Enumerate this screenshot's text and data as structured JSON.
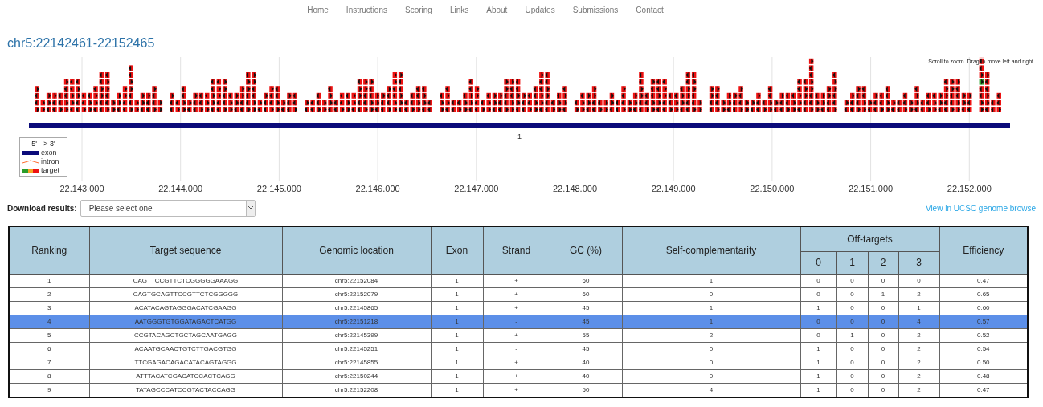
{
  "nav": [
    "Home",
    "Instructions",
    "Scoring",
    "Links",
    "About",
    "Updates",
    "Submissions",
    "Contact"
  ],
  "title": "chr5:22142461-22152465",
  "track": {
    "hint": "Scroll to zoom. Drag to move left and right",
    "exon_label": "1",
    "legend": {
      "title": "5' --> 3'",
      "items": [
        {
          "kind": "exon",
          "label": "exon"
        },
        {
          "kind": "intron",
          "label": "intron"
        },
        {
          "kind": "target",
          "label": "target"
        }
      ]
    },
    "ticks": [
      "22.143.000",
      "22.144.000",
      "22.145.000",
      "22.146.000",
      "22.147.000",
      "22.148.000",
      "22.149.000",
      "22.150.000",
      "22.151.000",
      "22.152.000"
    ]
  },
  "download": {
    "label": "Download results:",
    "placeholder": "Please select one"
  },
  "ucsc_link": "View in UCSC genome browse",
  "table": {
    "columns": [
      "Ranking",
      "Target sequence",
      "Genomic location",
      "Exon",
      "Strand",
      "GC (%)",
      "Self-complementarity"
    ],
    "group": "Off-targets",
    "sub_columns": [
      "0",
      "1",
      "2",
      "3"
    ],
    "last_column": "Efficiency",
    "rows": [
      {
        "selected": false,
        "cells": [
          "1",
          "CAGTTCCGTTCTCGGGGGAAAGG",
          "chr5:22152084",
          "1",
          "+",
          "60",
          "1",
          "0",
          "0",
          "0",
          "0",
          "0.47"
        ]
      },
      {
        "selected": false,
        "cells": [
          "2",
          "CAGTGCAGTTCCGTTCTCGGGGG",
          "chr5:22152079",
          "1",
          "+",
          "60",
          "0",
          "0",
          "0",
          "1",
          "2",
          "0.65"
        ]
      },
      {
        "selected": false,
        "cells": [
          "3",
          "ACATACAGTAGGGACATCGAAGG",
          "chr5:22145865",
          "1",
          "+",
          "45",
          "1",
          "1",
          "0",
          "0",
          "1",
          "0.60"
        ]
      },
      {
        "selected": true,
        "cells": [
          "4",
          "AATGGGTGTGGATAGACTCATGG",
          "chr5:22151218",
          "1",
          "-",
          "45",
          "1",
          "0",
          "0",
          "0",
          "4",
          "0.57"
        ]
      },
      {
        "selected": false,
        "cells": [
          "5",
          "CCGTACAGCTGCTAGCAATGAGG",
          "chr5:22145399",
          "1",
          "+",
          "55",
          "2",
          "0",
          "1",
          "0",
          "2",
          "0.52"
        ]
      },
      {
        "selected": false,
        "cells": [
          "6",
          "ACAATGCAACTGTCTTGACGTGG",
          "chr5:22145251",
          "1",
          "-",
          "45",
          "0",
          "1",
          "0",
          "0",
          "2",
          "0.54"
        ]
      },
      {
        "selected": false,
        "cells": [
          "7",
          "TTCGAGACAGACATACAGTAGGG",
          "chr5:22145855",
          "1",
          "+",
          "40",
          "0",
          "1",
          "0",
          "0",
          "2",
          "0.50"
        ]
      },
      {
        "selected": false,
        "cells": [
          "8",
          "ATTTACATCGACATCCACTCAGG",
          "chr5:22150244",
          "1",
          "+",
          "40",
          "0",
          "1",
          "0",
          "0",
          "2",
          "0.48"
        ]
      },
      {
        "selected": false,
        "cells": [
          "9",
          "TATAGCCCATCCGTACTACCAGG",
          "chr5:22152208",
          "1",
          "+",
          "50",
          "4",
          "1",
          "0",
          "0",
          "2",
          "0.47"
        ]
      }
    ]
  }
}
